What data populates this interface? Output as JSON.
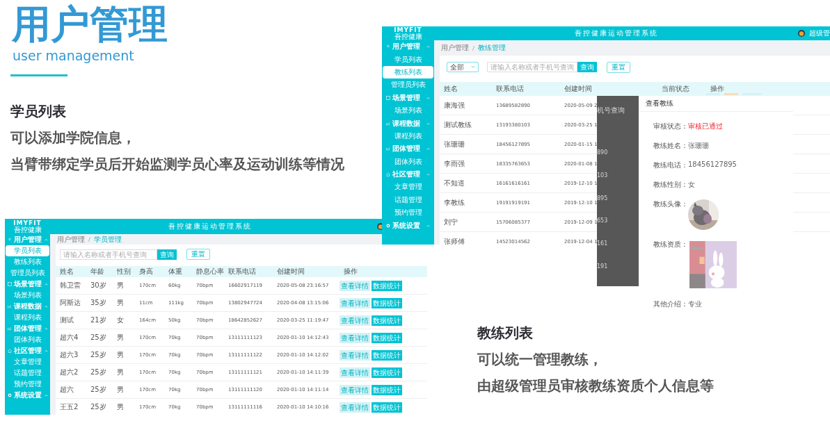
{
  "slide": {
    "title": "用户管理",
    "subtitle": "user management",
    "section_students": {
      "heading": "学员列表",
      "lines": [
        "可以添加学院信息，",
        "当臂带绑定学员后开始监测学员心率及运动训练等情况"
      ]
    },
    "section_coaches": {
      "heading": "教练列表",
      "lines": [
        "可以统一管理教练，",
        "由超级管理员审核教练资质个人信息等"
      ]
    }
  },
  "coach_screen": {
    "header": {
      "logo": "IMYFIT",
      "logo_sub": "吾控健康",
      "title": "吾控健康运动管理系统",
      "user": "超级管"
    },
    "sidebar": [
      {
        "label": "用户管理",
        "expanded": true,
        "children": [
          {
            "label": "学员列表",
            "selected": false
          },
          {
            "label": "教练列表",
            "selected": true
          },
          {
            "label": "管理员列表",
            "selected": false
          }
        ]
      },
      {
        "label": "场景管理",
        "expanded": true,
        "children": [
          {
            "label": "场景列表",
            "selected": false
          }
        ]
      },
      {
        "label": "课程数据",
        "expanded": true,
        "children": [
          {
            "label": "课程列表",
            "selected": false
          }
        ]
      },
      {
        "label": "团体管理",
        "expanded": true,
        "children": [
          {
            "label": "团体列表",
            "selected": false
          }
        ]
      },
      {
        "label": "社区管理",
        "expanded": true,
        "children": [
          {
            "label": "文章管理",
            "selected": false
          },
          {
            "label": "话题管理",
            "selected": false
          },
          {
            "label": "预约管理",
            "selected": false
          }
        ]
      },
      {
        "label": "系统设置",
        "expanded": true
      }
    ],
    "breadcrumb": [
      "用户管理",
      "教练管理"
    ],
    "filter": {
      "value": "全部"
    },
    "search": {
      "placeholder": "请输入名称或者手机号查询"
    },
    "buttons": [
      "查询",
      "重置"
    ],
    "columns": [
      "姓名",
      "联系电话",
      "创建时间",
      "当前状态",
      "操作"
    ],
    "rows": [
      {
        "name": "康海强",
        "phone": "13689582890",
        "created": "2020-05-09 2"
      },
      {
        "name": "测试教练",
        "phone": "13193380103",
        "created": "2020-03-25 1"
      },
      {
        "name": "张珊珊",
        "phone": "18456127895",
        "created": "2020-01-15 1"
      },
      {
        "name": "李雨强",
        "phone": "18335763653",
        "created": "2020-01-08 1"
      },
      {
        "name": "不知道",
        "phone": "16161616161",
        "created": "2019-12-10 1"
      },
      {
        "name": "李教练",
        "phone": "19191919191",
        "created": "2019-12-10 1"
      },
      {
        "name": "刘宁",
        "phone": "15706085377",
        "created": "2019-12-09 1"
      },
      {
        "name": "张师傅",
        "phone": "14523014562",
        "created": "2019-12-04 1"
      }
    ],
    "row_actions_peek": [
      {
        "color": "#d3f2f5"
      },
      {
        "color": "#f9dcb8"
      },
      {
        "color": "#d3f2f5"
      }
    ],
    "drawer": {
      "title": "查看教练",
      "backdrop_fragments": [
        "机号查询",
        "890",
        "103",
        "895",
        "653",
        "161",
        "191"
      ],
      "fields": [
        {
          "kind": "status",
          "label": "审核状态：",
          "value": "审核已通过"
        },
        {
          "kind": "text",
          "label": "教练姓名：",
          "value": "张珊珊"
        },
        {
          "kind": "text",
          "label": "教练电话：",
          "value": "18456127895"
        },
        {
          "kind": "text",
          "label": "教练性别：",
          "value": "女"
        },
        {
          "kind": "avatar",
          "label": "教练头像："
        },
        {
          "label": "教练资质："
        },
        {
          "kind": "text",
          "label": "其他介绍：",
          "value": "专业"
        }
      ]
    }
  },
  "student_screen": {
    "header": {
      "logo": "IMYFIT",
      "logo_sub": "吾控健康",
      "title": "吾控健康运动管理系统"
    },
    "sidebar": [
      {
        "label": "用户管理",
        "expanded": true,
        "children": [
          {
            "label": "学员列表",
            "selected": true
          },
          {
            "label": "教练列表",
            "selected": false
          },
          {
            "label": "管理员列表",
            "selected": false
          }
        ]
      },
      {
        "label": "场景管理",
        "expanded": true,
        "children": [
          {
            "label": "场景列表",
            "selected": false
          }
        ]
      },
      {
        "label": "课程数据",
        "expanded": true,
        "children": [
          {
            "label": "课程列表",
            "selected": false
          }
        ]
      },
      {
        "label": "团体管理",
        "expanded": true,
        "children": [
          {
            "label": "团体列表",
            "selected": false
          }
        ]
      },
      {
        "label": "社区管理",
        "expanded": true,
        "children": [
          {
            "label": "文章管理",
            "selected": false
          },
          {
            "label": "话题管理",
            "selected": false
          },
          {
            "label": "预约管理",
            "selected": false
          }
        ]
      },
      {
        "label": "系统设置",
        "expanded": true
      }
    ],
    "breadcrumb": [
      "用户管理",
      "学员管理"
    ],
    "search": {
      "placeholder": "请输入名称或者手机号查询"
    },
    "buttons": [
      "查询",
      "重置"
    ],
    "columns": [
      "姓名",
      "年龄",
      "性别",
      "身高",
      "体重",
      "静息心率",
      "联系电话",
      "创建时间",
      "操作"
    ],
    "rows": [
      {
        "cells": [
          "韩卫雷",
          "30岁",
          "男",
          "170cm",
          "60kg",
          "70bpm",
          "16602917119",
          "2020-05-08 23:16:57"
        ],
        "actions": [
          "查看详情",
          "数据统计"
        ]
      },
      {
        "cells": [
          "阿斯达",
          "35岁",
          "男",
          "11cm",
          "111kg",
          "70bpm",
          "13802947724",
          "2020-04-08 13:15:06"
        ],
        "actions": [
          "查看详情",
          "数据统计"
        ]
      },
      {
        "cells": [
          "测试",
          "21岁",
          "女",
          "164cm",
          "50kg",
          "70bpm",
          "18642852627",
          "2020-03-25 11:19:47"
        ],
        "actions": [
          "查看详情",
          "数据统计"
        ]
      },
      {
        "cells": [
          "超六4",
          "25岁",
          "男",
          "170cm",
          "70kg",
          "70bpm",
          "13111111123",
          "2020-01-10 14:12:43"
        ],
        "actions": [
          "查看详情",
          "数据统计"
        ]
      },
      {
        "cells": [
          "超六3",
          "25岁",
          "男",
          "170cm",
          "70kg",
          "70bpm",
          "13111111122",
          "2020-01-10 14:12:02"
        ],
        "actions": [
          "查看详情",
          "数据统计"
        ]
      },
      {
        "cells": [
          "超六2",
          "25岁",
          "男",
          "170cm",
          "70kg",
          "70bpm",
          "13111111121",
          "2020-01-10 14:11:39"
        ],
        "actions": [
          "查看详情",
          "数据统计"
        ]
      },
      {
        "cells": [
          "超六",
          "25岁",
          "男",
          "170cm",
          "70kg",
          "70bpm",
          "13111111120",
          "2020-01-10 14:11:14"
        ],
        "actions": [
          "查看详情",
          "数据统计"
        ]
      },
      {
        "cells": [
          "王五2",
          "25岁",
          "男",
          "170cm",
          "70kg",
          "70bpm",
          "13111111116",
          "2020-01-10 14:10:16"
        ],
        "actions": [
          "查看详情",
          "数据统计"
        ]
      }
    ]
  }
}
